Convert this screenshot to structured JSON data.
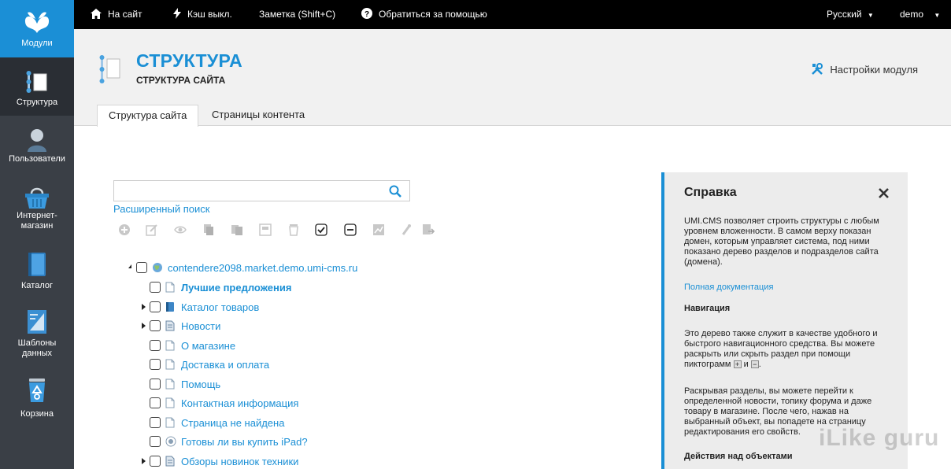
{
  "sidebar": {
    "items": [
      {
        "label": "Модули",
        "icon": "butterfly-logo-icon"
      },
      {
        "label": "Структура",
        "icon": "structure-icon"
      },
      {
        "label": "Пользователи",
        "icon": "user-icon"
      },
      {
        "label": "Интернет-\nмагазин",
        "icon": "basket-icon"
      },
      {
        "label": "Каталог",
        "icon": "book-icon"
      },
      {
        "label": "Шаблоны\nданных",
        "icon": "template-icon"
      },
      {
        "label": "Корзина",
        "icon": "recycle-bin-icon"
      }
    ]
  },
  "topbar": {
    "site_link": "На сайт",
    "cache": "Кэш выкл.",
    "note": "Заметка (Shift+C)",
    "help": "Обратиться за помощью",
    "language": "Русский",
    "user": "demo"
  },
  "header": {
    "title": "СТРУКТУРА",
    "subtitle": "СТРУКТУРА САЙТА",
    "settings": "Настройки модуля",
    "tabs": [
      "Структура сайта",
      "Страницы контента"
    ]
  },
  "search": {
    "value": "",
    "advanced": "Расширенный поиск"
  },
  "tree": {
    "root": "contendere2098.market.demo.umi-cms.ru",
    "items": [
      {
        "label": "Лучшие предложения",
        "bold": true,
        "expandable": false,
        "icon": "page-icon"
      },
      {
        "label": "Каталог товаров",
        "bold": false,
        "expandable": true,
        "icon": "catalog-icon"
      },
      {
        "label": "Новости",
        "bold": false,
        "expandable": true,
        "icon": "news-icon"
      },
      {
        "label": "О магазине",
        "bold": false,
        "expandable": false,
        "icon": "page-icon"
      },
      {
        "label": "Доставка и оплата",
        "bold": false,
        "expandable": false,
        "icon": "page-icon"
      },
      {
        "label": "Помощь",
        "bold": false,
        "expandable": false,
        "icon": "page-icon"
      },
      {
        "label": "Контактная информация",
        "bold": false,
        "expandable": false,
        "icon": "page-icon"
      },
      {
        "label": "Страница не найдена",
        "bold": false,
        "expandable": false,
        "icon": "page-icon"
      },
      {
        "label": "Готовы ли вы купить iPad?",
        "bold": false,
        "expandable": false,
        "icon": "poll-icon"
      },
      {
        "label": "Обзоры новинок техники",
        "bold": false,
        "expandable": true,
        "icon": "news-icon"
      }
    ]
  },
  "help": {
    "title": "Справка",
    "p1": "UMI.CMS позволяет строить структуры с любым уровнем вложенности. В самом верху показан домен, которым управляет система, под ними показано дерево разделов и подразделов сайта (домена).",
    "doc_link": "Полная документация",
    "h_nav": "Навигация",
    "p2a": "Это дерево также служит в качестве удобного и быстрого навигационного средства. Вы можете раскрыть или скрыть раздел при помощи пиктограмм",
    "p2_and": "и",
    "p3": "Раскрывая разделы, вы можете перейти к определенной новости, топику форума и даже товару в магазине. После чего, нажав на выбранный объект, вы попадете на страницу редактирования его свойств.",
    "h_actions": "Действия над объектами"
  },
  "watermark": "iLike guru",
  "colors": {
    "accent": "#1a8fd5",
    "sidebar": "#3a3f46",
    "topbar": "#000000"
  }
}
